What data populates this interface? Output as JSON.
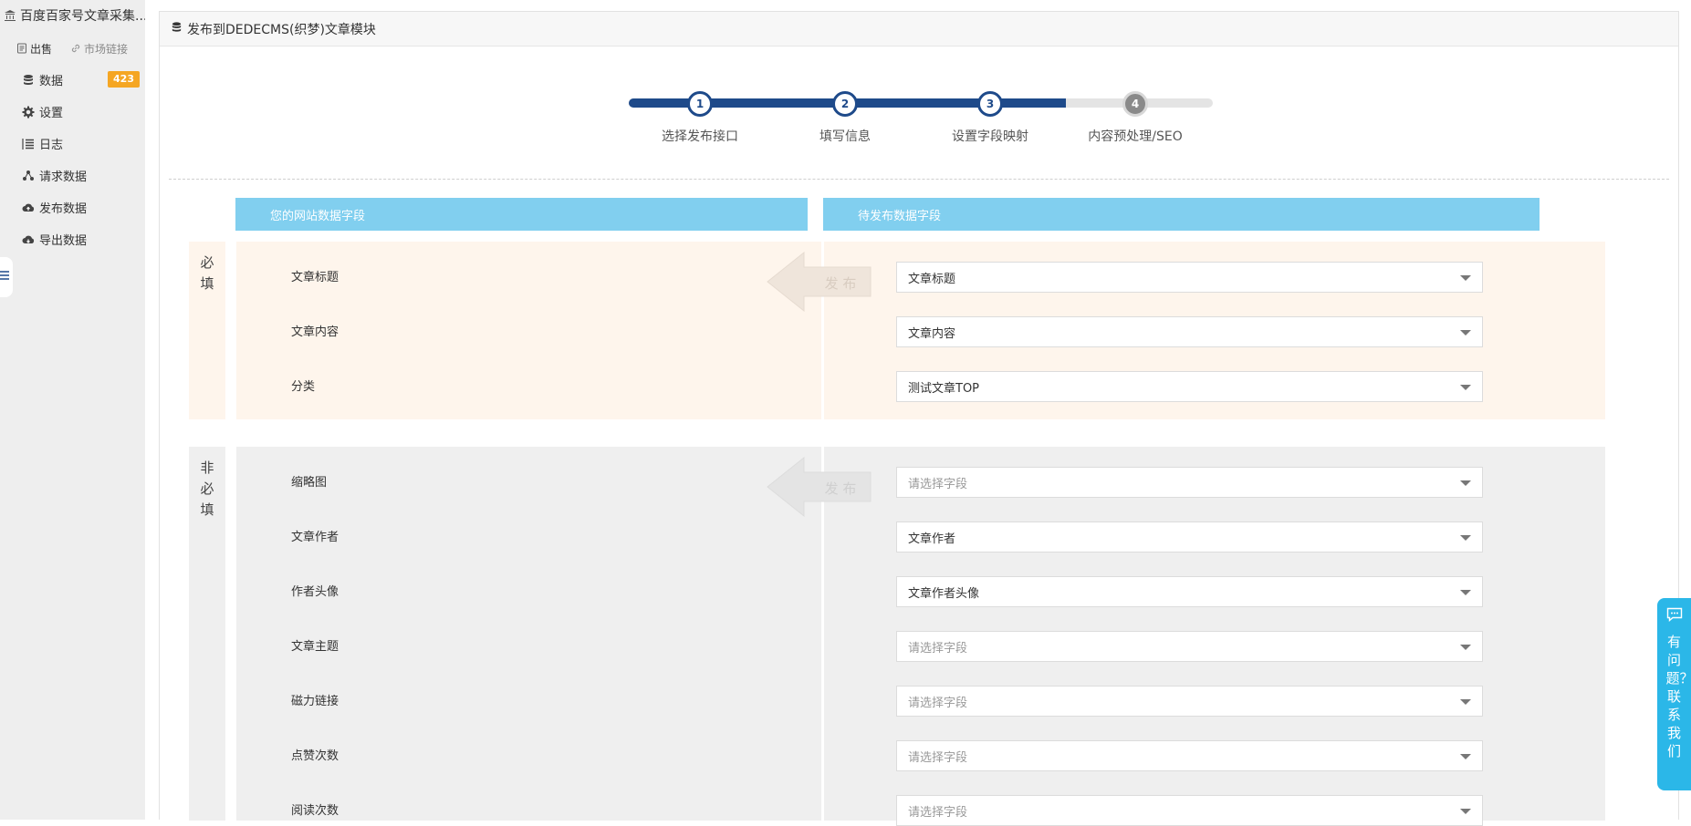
{
  "sidebar": {
    "app_title": "百度百家号文章采集...",
    "sub_links": {
      "sale": "出售",
      "market": "市场链接"
    },
    "nav": [
      {
        "label": "数据",
        "badge": "423",
        "icon": "database-icon"
      },
      {
        "label": "设置",
        "icon": "gear-icon"
      },
      {
        "label": "日志",
        "icon": "list-icon"
      },
      {
        "label": "请求数据",
        "icon": "nodes-icon"
      },
      {
        "label": "发布数据",
        "icon": "cloud-upload-icon"
      },
      {
        "label": "导出数据",
        "icon": "cloud-download-icon"
      }
    ]
  },
  "panel": {
    "title": "发布到DEDECMS(织梦)文章模块"
  },
  "stepper": {
    "steps": [
      {
        "num": "1",
        "label": "选择发布接口"
      },
      {
        "num": "2",
        "label": "填写信息"
      },
      {
        "num": "3",
        "label": "设置字段映射"
      },
      {
        "num": "4",
        "label": "内容预处理/SEO"
      }
    ],
    "current": 3
  },
  "columns": {
    "site_fields": "您的网站数据字段",
    "publish_fields": "待发布数据字段"
  },
  "arrow_text": "发 布",
  "required": {
    "label": [
      "必",
      "填"
    ],
    "fields": [
      {
        "name": "文章标题",
        "value": "文章标题"
      },
      {
        "name": "文章内容",
        "value": "文章内容"
      },
      {
        "name": "分类",
        "value": "测试文章TOP"
      }
    ]
  },
  "optional": {
    "label": [
      "非",
      "必",
      "填"
    ],
    "placeholder": "请选择字段",
    "fields": [
      {
        "name": "缩略图",
        "value": ""
      },
      {
        "name": "文章作者",
        "value": "文章作者"
      },
      {
        "name": "作者头像",
        "value": "文章作者头像"
      },
      {
        "name": "文章主题",
        "value": ""
      },
      {
        "name": "磁力链接",
        "value": ""
      },
      {
        "name": "点赞次数",
        "value": ""
      },
      {
        "name": "阅读次数",
        "value": ""
      }
    ]
  },
  "help": {
    "text": "有问题？联系我们"
  },
  "colors": {
    "accent": "#1e4a8a",
    "header_blue": "#81cfef",
    "badge": "#f5a623",
    "help": "#2bb7e8"
  }
}
